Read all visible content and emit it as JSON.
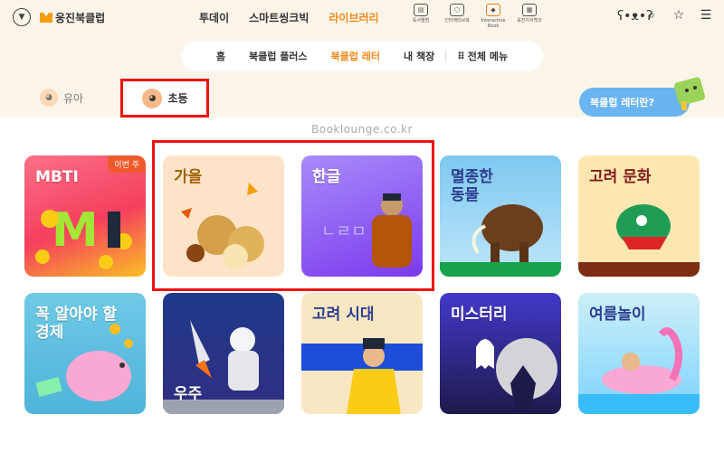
{
  "header": {
    "logo_text": "웅진북클럽",
    "nav": [
      "투데이",
      "스마트씽크빅",
      "라이브러리"
    ],
    "active_nav": "라이브러리",
    "quick_links": [
      {
        "label": "독서앨범",
        "icon": "album-icon"
      },
      {
        "label": "인터랙티브북",
        "icon": "box-icon"
      },
      {
        "label": "Interactive Book",
        "icon": "interactive-book-icon"
      },
      {
        "label": "웅진지식백과",
        "icon": "encyclopedia-icon"
      }
    ],
    "right_icons": [
      "bear-icon",
      "search-icon",
      "star-icon",
      "menu-icon"
    ]
  },
  "subnav": {
    "items": [
      "홈",
      "북클럽 플러스",
      "북클럽 레터",
      "내 책장",
      "전체 메뉴"
    ],
    "active": "북클럽 레터"
  },
  "age_tabs": {
    "baby": "유아",
    "elementary": "초등",
    "selected": "초등"
  },
  "info_button": "북클럽 레터란?",
  "watermark": "Booklounge.co.kr",
  "cards": [
    {
      "title": "MBTI",
      "badge": "이번 주",
      "bg": "#f87171"
    },
    {
      "title": "가을",
      "bg": "#fde4c8"
    },
    {
      "title": "한글",
      "bg": "#8b5cf6"
    },
    {
      "title": "멸종한\n동물",
      "bg": "#7dc8ef"
    },
    {
      "title": "고려 문화",
      "bg": "#fde7b0"
    },
    {
      "title": "꼭 알아야 할\n경제",
      "bg": "#7ccfe8"
    },
    {
      "title": "우주",
      "bg": "#1e3a8a"
    },
    {
      "title": "고려 시대",
      "bg": "#f9e7c3"
    },
    {
      "title": "미스터리",
      "bg": "#312e81"
    },
    {
      "title": "여름놀이",
      "bg": "#a7e3f2"
    }
  ],
  "colors": {
    "accent": "#f08a1a",
    "highlight": "#e11d1d",
    "band": "#fbf4e9"
  }
}
